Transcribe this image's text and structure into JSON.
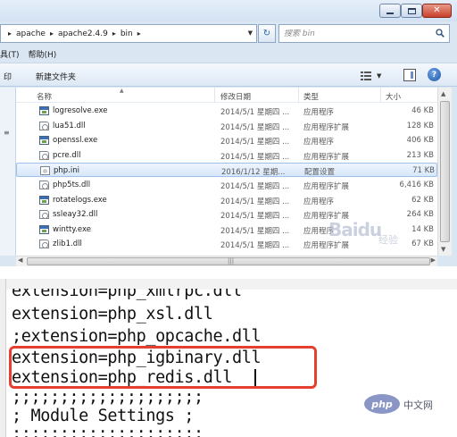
{
  "explorer": {
    "address": {
      "crumbs": [
        "apache",
        "apache2.4.9",
        "bin"
      ],
      "separator": "▸"
    },
    "search": {
      "placeholder": "搜索 bin"
    },
    "menubar": {
      "items": [
        "具(T)",
        "帮助(H)"
      ]
    },
    "toolbar": {
      "left_label": "印",
      "new_folder": "新建文件夹"
    },
    "columns": {
      "name": "名称",
      "date": "修改日期",
      "type": "类型",
      "size": "大小"
    },
    "files": [
      {
        "name": "logresolve.exe",
        "date": "2014/5/1 星期四 ...",
        "type": "应用程序",
        "size": "46 KB",
        "icon": "exe"
      },
      {
        "name": "lua51.dll",
        "date": "2014/5/1 星期四 ...",
        "type": "应用程序扩展",
        "size": "128 KB",
        "icon": "dll"
      },
      {
        "name": "openssl.exe",
        "date": "2014/5/1 星期四 ...",
        "type": "应用程序",
        "size": "406 KB",
        "icon": "exe"
      },
      {
        "name": "pcre.dll",
        "date": "2014/5/1 星期四 ...",
        "type": "应用程序扩展",
        "size": "213 KB",
        "icon": "dll"
      },
      {
        "name": "php.ini",
        "date": "2016/1/12 星期...",
        "type": "配置设置",
        "size": "71 KB",
        "icon": "ini",
        "selected": true
      },
      {
        "name": "php5ts.dll",
        "date": "2014/5/1 星期四 ...",
        "type": "应用程序扩展",
        "size": "6,416 KB",
        "icon": "dll"
      },
      {
        "name": "rotatelogs.exe",
        "date": "2014/5/1 星期四 ...",
        "type": "应用程序",
        "size": "62 KB",
        "icon": "exe"
      },
      {
        "name": "ssleay32.dll",
        "date": "2014/5/1 星期四 ...",
        "type": "应用程序扩展",
        "size": "264 KB",
        "icon": "dll"
      },
      {
        "name": "wintty.exe",
        "date": "2014/5/1 星期四 ...",
        "type": "应用程序",
        "size": "14 KB",
        "icon": "exe"
      },
      {
        "name": "zlib1.dll",
        "date": "2014/5/1 星期四 ...",
        "type": "应用程序扩展",
        "size": "67 KB",
        "icon": "dll"
      }
    ],
    "watermark": {
      "text": "Baidu",
      "sub": "经验"
    },
    "colors": {
      "chrome": "#dbe6f3",
      "selection": "#d7e7fa",
      "selection_border": "#9cc0e9"
    }
  },
  "editor": {
    "lines": [
      "extension=php_xmlrpc.dll",
      "extension=php_xsl.dll",
      ";extension=php_opcache.dll",
      "extension=php_igbinary.dll",
      "extension=php_redis.dll",
      ";;;;;;;;;;;;;;;;;;;;",
      "; Module Settings ;",
      ";;;;;;;;;;;;;;;;;;;;"
    ],
    "highlight_color": "#e53f2f",
    "brand": {
      "logo": "php",
      "site": "中文网"
    }
  }
}
